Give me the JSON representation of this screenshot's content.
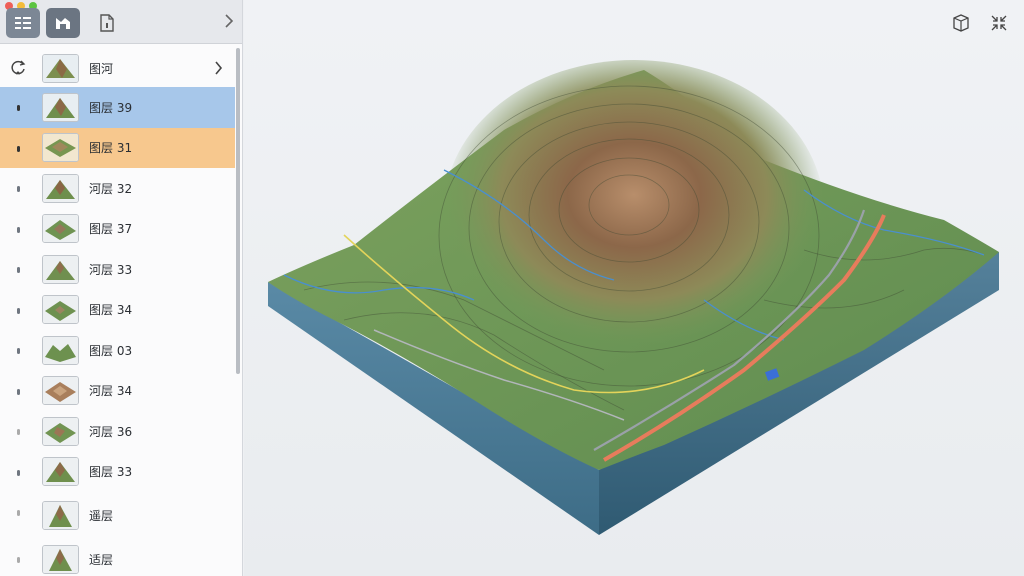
{
  "toolbar": {
    "traffic_colors": [
      "#ee5e57",
      "#f3bc3a",
      "#5cc442"
    ],
    "tabs": [
      {
        "name": "layers-list-icon",
        "active": true
      },
      {
        "name": "map-mode-icon",
        "active": true
      },
      {
        "name": "document-icon",
        "active": false
      }
    ]
  },
  "tree": {
    "root_label": "图河",
    "layers": [
      {
        "label": "图层 39",
        "state": "blue",
        "thumb": "mountain"
      },
      {
        "label": "图层 31",
        "state": "orange",
        "thumb": "plateau"
      },
      {
        "label": "河层 32",
        "state": "",
        "thumb": "mountain"
      },
      {
        "label": "图层 37",
        "state": "",
        "thumb": "plateau"
      },
      {
        "label": "河层 33",
        "state": "",
        "thumb": "mountain"
      },
      {
        "label": "图层 34",
        "state": "",
        "thumb": "plateau"
      },
      {
        "label": "图层 03",
        "state": "",
        "thumb": "valley"
      },
      {
        "label": "河层 34",
        "state": "",
        "thumb": "brown"
      },
      {
        "label": "河层 36",
        "state": "",
        "thumb": "plateau"
      },
      {
        "label": "图层 33",
        "state": "",
        "thumb": "mountain"
      },
      {
        "label": "遥层",
        "state": "",
        "thumb": "mountain"
      },
      {
        "label": "适层",
        "state": "",
        "thumb": "mountain"
      }
    ]
  },
  "viewport": {
    "icons": [
      "cube-icon",
      "collapse-arrows-icon"
    ],
    "colors": {
      "terrain_green": "#6f9a58",
      "terrain_brown": "#8a6446",
      "water": "#4a8fcf",
      "road": "#e77c5c",
      "side": "#3f6d86"
    }
  }
}
